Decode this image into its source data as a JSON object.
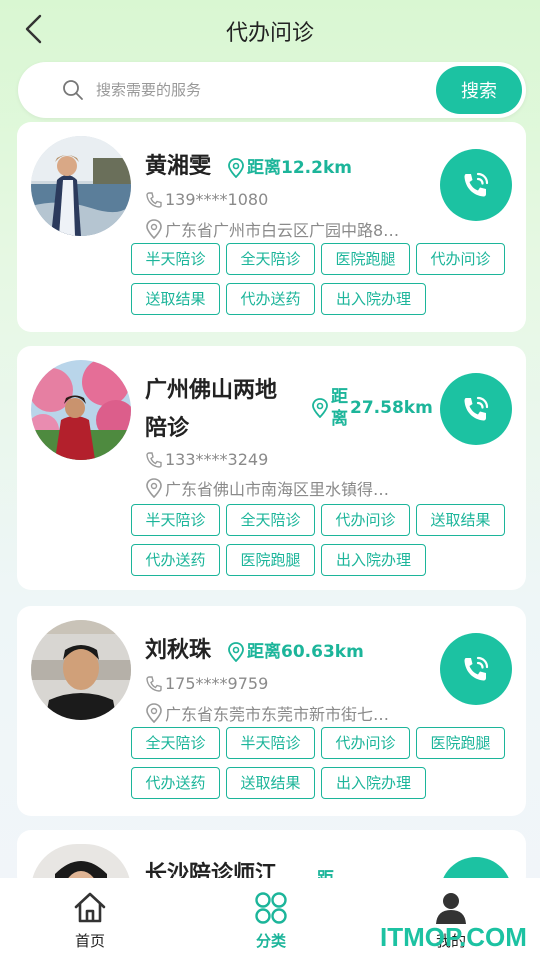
{
  "header": {
    "title": "代办问诊"
  },
  "search": {
    "placeholder": "搜索需要的服务",
    "button_label": "搜索"
  },
  "cards": [
    {
      "name": "黄湘雯",
      "distance": "距离12.2km",
      "phone": "139****1080",
      "address": "广东省广州市白云区广园中路8…",
      "tags": [
        "半天陪诊",
        "全天陪诊",
        "医院跑腿",
        "代办问诊",
        "送取结果",
        "代办送药",
        "出入院办理"
      ]
    },
    {
      "name_line1": "广州佛山两地",
      "name_line2": "陪诊",
      "distance_line1": "距",
      "distance_line2": "离",
      "distance_value": "27.58km",
      "phone": "133****3249",
      "address": "广东省佛山市南海区里水镇得…",
      "tags": [
        "半天陪诊",
        "全天陪诊",
        "代办问诊",
        "送取结果",
        "代办送药",
        "医院跑腿",
        "出入院办理"
      ]
    },
    {
      "name": "刘秋珠",
      "distance": "距离60.63km",
      "phone": "175****9759",
      "address": "广东省东莞市东莞市新市街七…",
      "tags": [
        "全天陪诊",
        "半天陪诊",
        "代办问诊",
        "医院跑腿",
        "代办送药",
        "送取结果",
        "出入院办理"
      ]
    },
    {
      "name": "长沙陪诊师江",
      "distance": "距"
    }
  ],
  "tabbar": {
    "items": [
      {
        "label": "首页",
        "icon": "home-icon"
      },
      {
        "label": "分类",
        "icon": "category-icon"
      },
      {
        "label": "我的",
        "icon": "user-icon"
      }
    ],
    "active": "分类"
  },
  "watermark": "ITMOP.COM",
  "colors": {
    "accent": "#1cc2a2",
    "accent_text": "#1cb59a",
    "background_top": "#d9f7d2"
  }
}
